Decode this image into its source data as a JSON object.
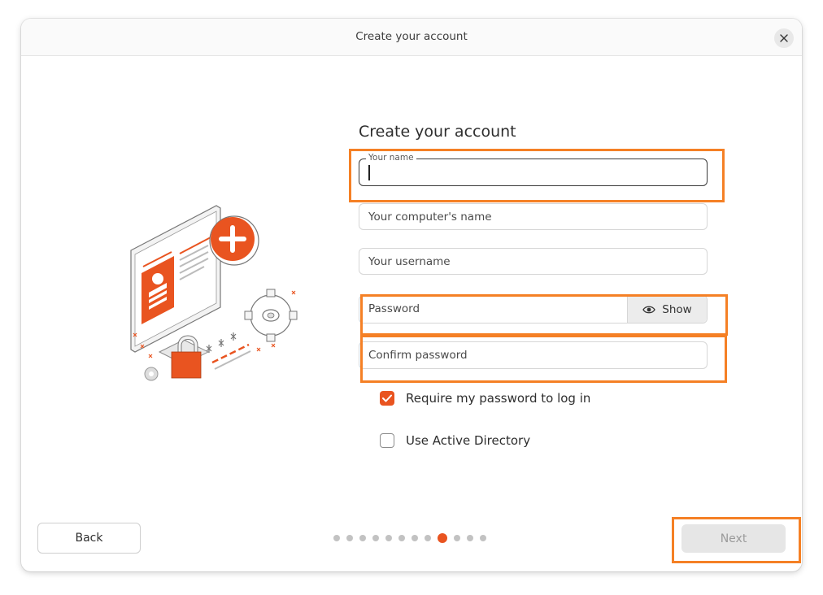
{
  "window": {
    "title": "Create your account"
  },
  "form": {
    "heading": "Create your account",
    "name_label": "Your name",
    "computer_name_placeholder": "Your computer's name",
    "username_placeholder": "Your username",
    "password_placeholder": "Password",
    "show_label": "Show",
    "confirm_placeholder": "Confirm password"
  },
  "options": {
    "require_password": {
      "label": "Require my password to log in",
      "checked": true
    },
    "active_directory": {
      "label": "Use Active Directory",
      "checked": false
    }
  },
  "footer": {
    "back_label": "Back",
    "next_label": "Next",
    "steps_total": 12,
    "steps_current": 9
  },
  "colors": {
    "accent": "#e95420",
    "highlight": "#f58025"
  },
  "icons": [
    "close-icon",
    "eye-icon",
    "checkmark-icon"
  ]
}
